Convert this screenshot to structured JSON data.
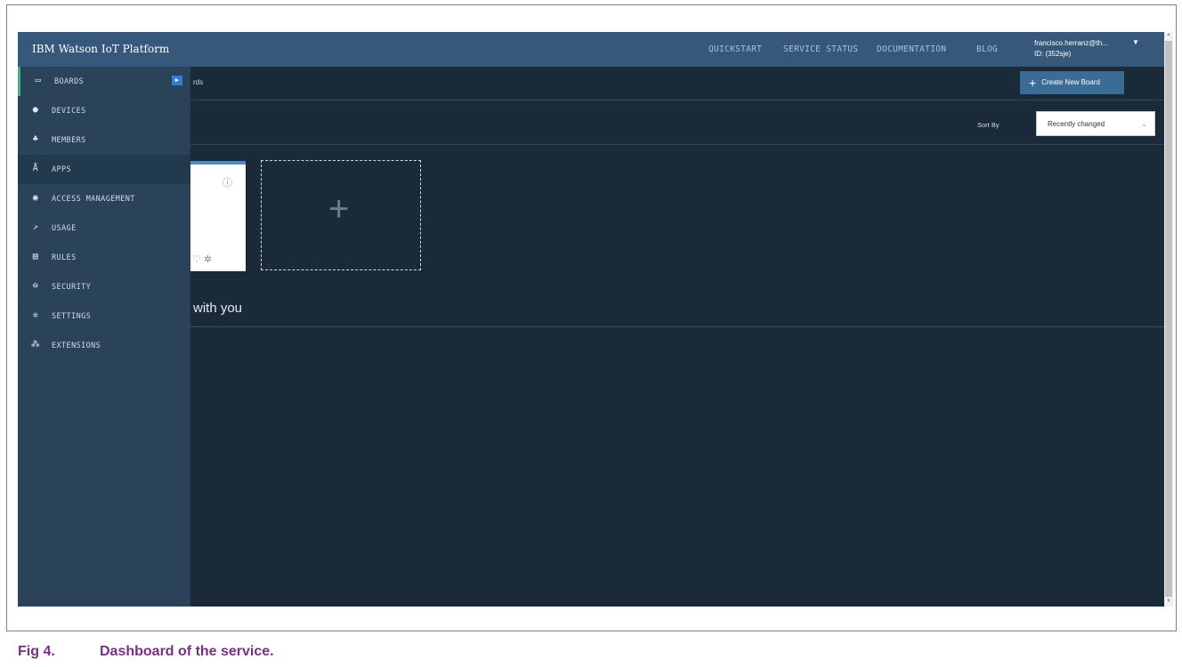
{
  "app": {
    "brand": "IBM Watson IoT Platform",
    "topnav": [
      "QUICKSTART",
      "SERVICE STATUS",
      "DOCUMENTATION",
      "BLOG"
    ],
    "user": {
      "name": "francisco.herranz@th...",
      "id": "ID: (352sje)"
    }
  },
  "breadcrumb": "rds",
  "create_button": "Create New Board",
  "sort": {
    "label": "Sort By",
    "value": "Recently changed"
  },
  "shared_section": {
    "title": "with you"
  },
  "sidebar": {
    "items": [
      {
        "label": "BOARDS",
        "icon": "boards-icon"
      },
      {
        "label": "DEVICES",
        "icon": "devices-icon"
      },
      {
        "label": "MEMBERS",
        "icon": "members-icon"
      },
      {
        "label": "APPS",
        "icon": "apps-icon"
      },
      {
        "label": "ACCESS MANAGEMENT",
        "icon": "access-icon"
      },
      {
        "label": "USAGE",
        "icon": "usage-icon"
      },
      {
        "label": "RULES",
        "icon": "rules-icon"
      },
      {
        "label": "SECURITY",
        "icon": "lock-icon"
      },
      {
        "label": "SETTINGS",
        "icon": "gear-icon"
      },
      {
        "label": "EXTENSIONS",
        "icon": "extensions-icon"
      }
    ]
  },
  "caption": {
    "number": "Fig 4.",
    "text": "Dashboard of the service."
  },
  "colors": {
    "topbar": "#36587a",
    "sidebar": "#2a4358",
    "background": "#1b2a38",
    "active_indicator": "#3db77a",
    "caption": "#7a2f84"
  }
}
